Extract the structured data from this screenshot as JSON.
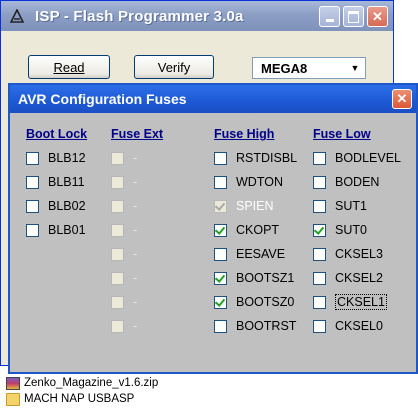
{
  "main_window": {
    "title": "ISP - Flash Programmer  3.0a",
    "read_label": "Read",
    "verify_label": "Verify",
    "device": "MEGA8"
  },
  "dialog": {
    "title": "AVR  Configuration Fuses",
    "columns": [
      {
        "header": "Boot Lock",
        "items": [
          {
            "label": "BLB12",
            "checked": false
          },
          {
            "label": "BLB11",
            "checked": false
          },
          {
            "label": "BLB02",
            "checked": false
          },
          {
            "label": "BLB01",
            "checked": false
          }
        ]
      },
      {
        "header": "Fuse Ext",
        "items": [
          {
            "label": "-"
          },
          {
            "label": "-"
          },
          {
            "label": "-"
          },
          {
            "label": "-"
          },
          {
            "label": "-"
          },
          {
            "label": "-"
          },
          {
            "label": "-"
          },
          {
            "label": "-"
          }
        ]
      },
      {
        "header": "Fuse High",
        "items": [
          {
            "label": "RSTDISBL",
            "checked": false
          },
          {
            "label": "WDTON",
            "checked": false
          },
          {
            "label": "SPIEN",
            "checked": true,
            "disabled": true
          },
          {
            "label": "CKOPT",
            "checked": true
          },
          {
            "label": "EESAVE",
            "checked": false
          },
          {
            "label": "BOOTSZ1",
            "checked": true
          },
          {
            "label": "BOOTSZ0",
            "checked": true
          },
          {
            "label": "BOOTRST",
            "checked": false
          }
        ]
      },
      {
        "header": "Fuse Low",
        "items": [
          {
            "label": "BODLEVEL",
            "checked": false
          },
          {
            "label": "BODEN",
            "checked": false
          },
          {
            "label": "SUT1",
            "checked": false
          },
          {
            "label": "SUT0",
            "checked": true
          },
          {
            "label": "CKSEL3",
            "checked": false
          },
          {
            "label": "CKSEL2",
            "checked": false
          },
          {
            "label": "CKSEL1",
            "checked": false,
            "focused": true
          },
          {
            "label": "CKSEL0",
            "checked": false
          }
        ]
      }
    ]
  },
  "desktop": {
    "files": [
      {
        "name": "Zenko_Magazine_v1.6.zip",
        "icon": "zip-archive-icon"
      },
      {
        "name": "MACH NAP USBASP",
        "icon": "folder-icon"
      }
    ]
  }
}
